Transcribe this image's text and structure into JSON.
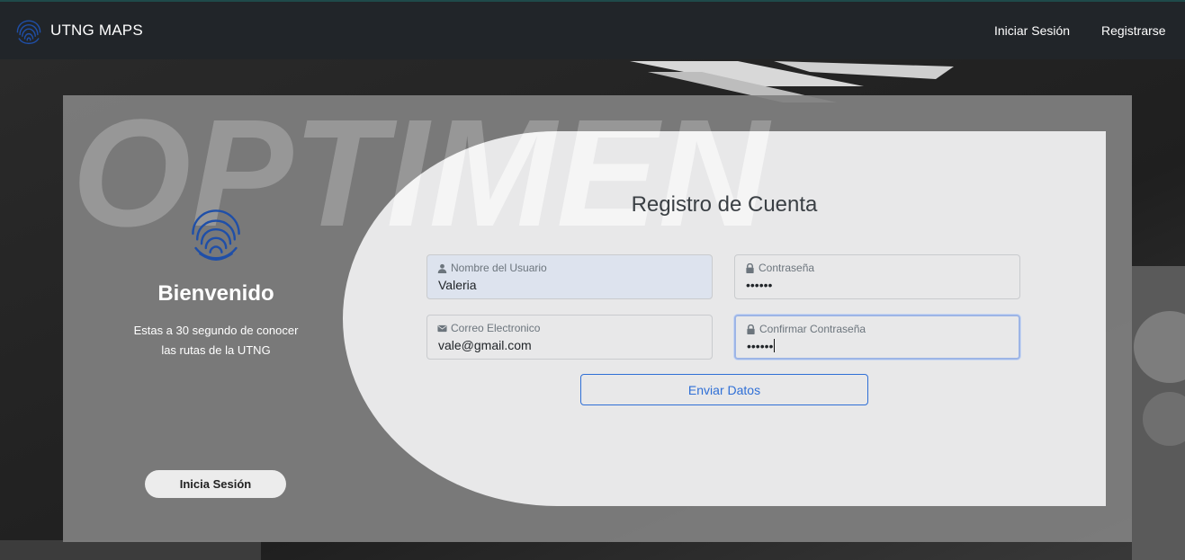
{
  "navbar": {
    "brand": "UTNG MAPS",
    "login_link": "Iniciar Sesión",
    "register_link": "Registrarse"
  },
  "welcome": {
    "title": "Bienvenido",
    "text": "Estas a 30 segundo de conocer las rutas de la UTNG",
    "login_button": "Inicia Sesión"
  },
  "watermark_text": "OPTIMEN",
  "form": {
    "title": "Registro de Cuenta",
    "fields": {
      "username": {
        "label": "Nombre del Usuario",
        "value": "Valeria",
        "icon": "user-icon"
      },
      "password": {
        "label": "Contraseña",
        "value": "••••••",
        "icon": "lock-icon"
      },
      "email": {
        "label": "Correo Electronico",
        "value": "vale@gmail.com",
        "icon": "envelope-icon"
      },
      "confirm_password": {
        "label": "Confirmar Contraseña",
        "value": "••••••",
        "icon": "lock-icon"
      }
    },
    "submit": "Enviar Datos"
  },
  "colors": {
    "navbar": "#212529",
    "accent": "#2f6fd6",
    "logo": "#1f4fa8"
  }
}
